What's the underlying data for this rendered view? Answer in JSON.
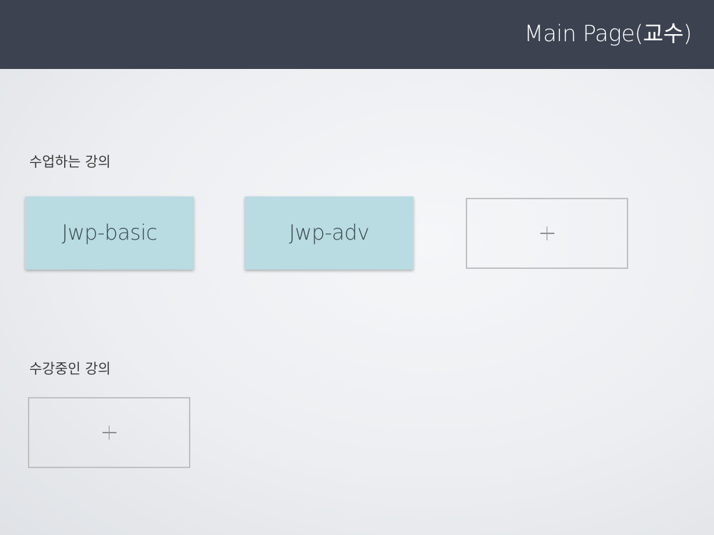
{
  "header": {
    "title": "Main Page(교수)"
  },
  "teaching": {
    "label": "수업하는 강의",
    "courses": [
      {
        "name": "Jwp-basic"
      },
      {
        "name": "Jwp-adv"
      }
    ],
    "add_icon": "plus-icon"
  },
  "enrolled": {
    "label": "수강중인 강의",
    "add_icon": "plus-icon"
  },
  "colors": {
    "header_bg": "#3c4250",
    "course_card_bg": "#b9dbe2",
    "add_card_border": "#bfc0c2"
  }
}
